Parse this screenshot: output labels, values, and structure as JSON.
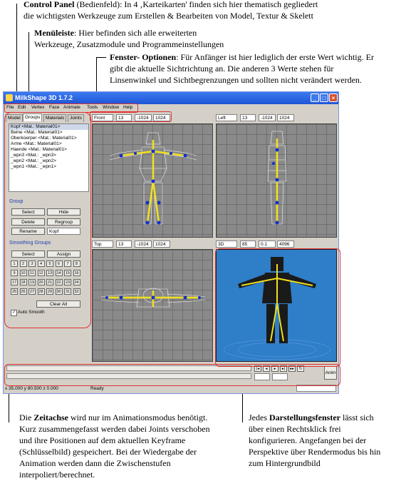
{
  "annotations": {
    "control_panel": {
      "bold": "Control Panel",
      "line1_rest": " (Bedienfeld): In 4 ‚Karteikarten' finden sich hier thematisch gegliedert",
      "line2": "die wichtigsten Werkzeuge zum Erstellen & Bearbeiten von Model, Textur & Skelett"
    },
    "menuleiste": {
      "bold": "Menüleiste",
      "line1_rest": ": Hier befinden sich alle  erweiterten",
      "line2": "Werkzeuge, Zusatzmodule und Programmeinstellungen"
    },
    "fenster": {
      "bold": "Fenster- Optionen",
      "line1_rest": ": Für Anfänger ist hier lediglich der erste Wert wichtig. Er",
      "line2": "gibt die aktuelle Sichtrichtung an. Die anderen 3 Werte stehen für",
      "line3": "Linsenwinkel und Sichtbegrenzungen und sollten nicht verändert werden."
    },
    "zeitachse": {
      "pre": "Die ",
      "bold": "Zeitachse",
      "line1_rest": " wird nur im Animationsmodus benötigt.",
      "line2": "Kurz zusammengefasst werden dabei Joints verschoben",
      "line3": "und ihre Positionen auf dem aktuellen Keyframe",
      "line4": "(Schlüsselbild) gespeichert. Bei der Wiedergabe der",
      "line5": "Animation werden dann die Zwischenstufen",
      "line6": "interpoliert/berechnet."
    },
    "darstellung": {
      "pre": "Jedes ",
      "bold": "Darstellungsfenster",
      "line1_rest": " lässt sich",
      "line2": "über einen Rechtsklick frei",
      "line3": "konfigurieren. Angefangen bei der",
      "line4": "Perspektive über Rendermodus bis hin",
      "line5": "zum Hintergrundbild"
    }
  },
  "window": {
    "title": "MilkShape 3D 1.7.2",
    "menu": [
      "File",
      "Edit",
      "Vertex",
      "Face",
      "Animate",
      "Tools",
      "Window",
      "Help"
    ],
    "tabs": [
      "Model",
      "Groups",
      "Materials",
      "Joints"
    ],
    "groups_list": [
      "Kopf <Mat.: Material01>",
      "Beine <Mat.: Material01>",
      "Oberkoerper <Mat.: Material01>",
      "Arme <Mat.: Material01>",
      "Haende <Mat.: Material01>",
      "_wpn3 <Mat.: _wpn3>",
      "_wpn2 <Mat.: _wpn2>",
      "_wpn1 <Mat.: _wpn1>"
    ],
    "group_label": "Group",
    "buttons": {
      "select": "Select",
      "hide": "Hide",
      "delete": "Delete",
      "regroup": "Regroup",
      "rename": "Rename",
      "assign": "Assign",
      "clear_all": "Clear All",
      "anim": "Anim"
    },
    "rename_value": "Kopf",
    "smoothing_label": "Smoothing Groups",
    "smoothing_numbers": [
      "1",
      "2",
      "3",
      "4",
      "5",
      "6",
      "7",
      "8",
      "9",
      "10",
      "11",
      "12",
      "13",
      "14",
      "15",
      "16",
      "17",
      "18",
      "19",
      "20",
      "21",
      "22",
      "23",
      "24",
      "25",
      "26",
      "27",
      "28",
      "29",
      "30",
      "31",
      "32"
    ],
    "auto_smooth": "Auto Smooth",
    "viewports": [
      {
        "view": "Front",
        "v1": "13",
        "v2": "-1024",
        "v3": "1024"
      },
      {
        "view": "Left",
        "v1": "13",
        "v2": "-1024",
        "v3": "1024"
      },
      {
        "view": "Top",
        "v1": "13",
        "v2": "-1024",
        "v3": "1024"
      },
      {
        "view": "3D",
        "v1": "85",
        "v2": "0.1",
        "v3": "4096"
      }
    ],
    "status": {
      "coords": "x 35.000 y 80.500 z 0.000",
      "state": "Ready"
    }
  },
  "colors": {
    "highlight": "#e03030",
    "viewport_3d": "#2e7ec8",
    "bones": "#f0e020"
  }
}
